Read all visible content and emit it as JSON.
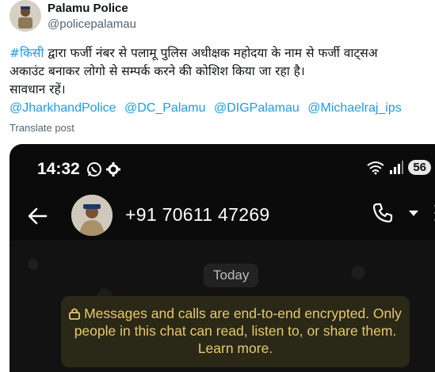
{
  "author": {
    "name": "Palamu Police",
    "handle": "@policepalamau"
  },
  "tweet": {
    "hashtag": "#किसी",
    "line1_rest": " द्वारा फर्जी नंबर से पलामू पुलिस अधीक्षक महोदया के नाम से फर्जी वाट्सअ",
    "line2": "अकाउंट बनाकर लोगो से सम्पर्क करने की कोशिश किया जा रहा है।",
    "line3": "सावधान रहें।",
    "mentions": [
      "@JharkhandPolice",
      "@DC_Palamu",
      "@DIGPalamau",
      "@Michaelraj_ips"
    ],
    "translate_label": "Translate post"
  },
  "phone": {
    "time": "14:32",
    "battery": "56",
    "contact_number": "+91 70611 47269",
    "date_chip": "Today",
    "encryption_notice": "Messages and calls are end-to-end encrypted. Only people in this chat can read, listen to, or share them. Learn more."
  },
  "colors": {
    "link": "#1d9bf0",
    "encryption_text": "#e8c96a",
    "encryption_bg": "#2a2817"
  },
  "icons": {
    "status_left": [
      "whatsapp-icon",
      "gear-icon"
    ],
    "status_right": [
      "wifi-icon",
      "signal-icon"
    ],
    "header": [
      "back-arrow-icon",
      "phone-call-icon",
      "dropdown-icon",
      "more-vertical-icon"
    ],
    "notice": "lock-icon"
  }
}
